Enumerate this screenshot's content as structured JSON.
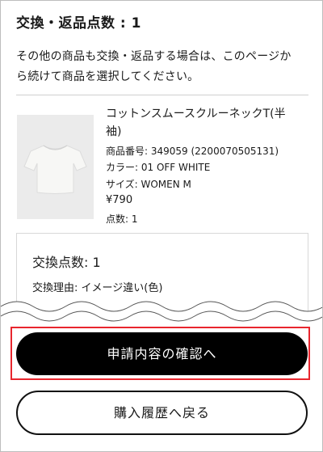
{
  "header": {
    "count_title": "交換・返品点数 : 1",
    "instructions_line1": "その他の商品も交換・返品する場合は、このページか",
    "instructions_line2": "ら続けて商品を選択してください。"
  },
  "product": {
    "name_line1": "コットンスムースクルーネックT(半",
    "name_line2": "袖)",
    "code": "商品番号: 349059  (2200070505131)",
    "color": "カラー: 01 OFF WHITE",
    "size": "サイズ: WOMEN M",
    "price": "¥790",
    "quantity": "点数: 1",
    "image_icon": "tshirt-icon",
    "image_color": "#f7f7f5"
  },
  "exchange": {
    "count": "交換点数: 1",
    "reason": "交換理由: イメージ違い(色)"
  },
  "actions": {
    "confirm_label": "申請内容の確認へ",
    "back_label": "購入履歴へ戻る"
  },
  "colors": {
    "primary_button": "#000000",
    "highlight": "#e8262e"
  }
}
